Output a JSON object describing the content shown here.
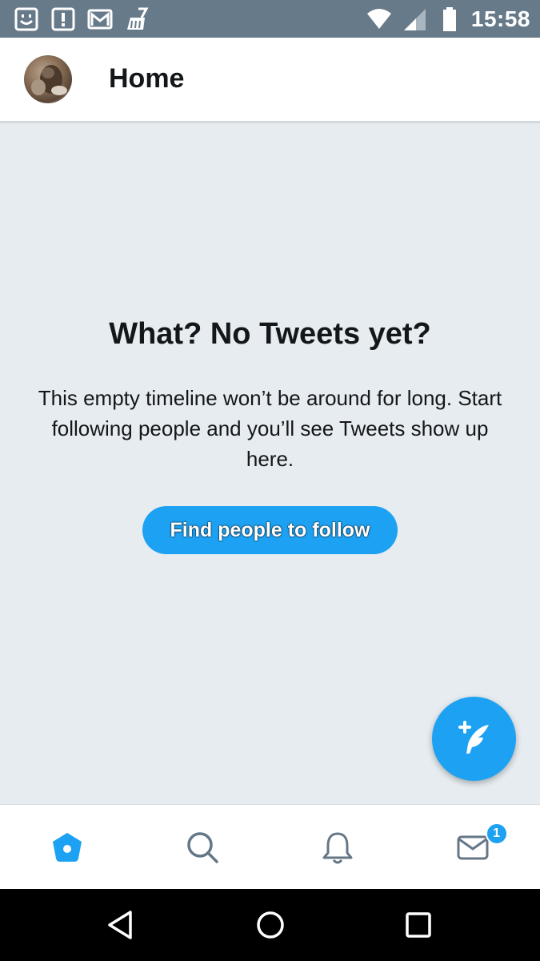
{
  "status_bar": {
    "time": "15:58",
    "left_icons": [
      "bot-face-icon",
      "alert-icon",
      "gmail-icon",
      "cleaner-icon"
    ],
    "right_icons": [
      "wifi-icon",
      "cell-signal-icon",
      "battery-icon"
    ]
  },
  "header": {
    "title": "Home"
  },
  "empty_state": {
    "title": "What? No Tweets yet?",
    "body": "This empty timeline won’t be around for long. Start following people and you’ll see Tweets show up here.",
    "button_label": "Find people to follow"
  },
  "bottom_nav": {
    "items": [
      {
        "name": "home",
        "icon": "home-icon",
        "active": true
      },
      {
        "name": "search",
        "icon": "search-icon",
        "active": false
      },
      {
        "name": "notifications",
        "icon": "bell-icon",
        "active": false
      },
      {
        "name": "messages",
        "icon": "mail-icon",
        "active": false,
        "badge": "1"
      }
    ]
  },
  "colors": {
    "accent": "#1da1f2",
    "status_bar": "#677a8a",
    "background": "#e6ecf0"
  }
}
